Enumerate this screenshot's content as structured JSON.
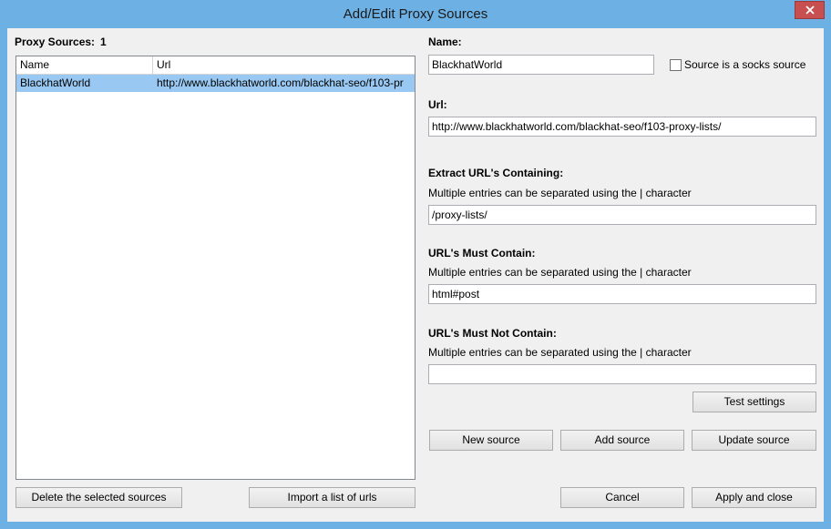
{
  "window": {
    "title": "Add/Edit Proxy Sources"
  },
  "sources": {
    "label": "Proxy Sources:",
    "count": "1",
    "columns": [
      "Name",
      "Url"
    ],
    "rows": [
      {
        "name": "BlackhatWorld",
        "url": "http://www.blackhatworld.com/blackhat-seo/f103-pr"
      }
    ],
    "delete_button": "Delete the selected sources",
    "import_button": "Import a list of urls"
  },
  "form": {
    "name_label": "Name:",
    "name_value": "BlackhatWorld",
    "socks_label": "Source is a socks source",
    "url_label": "Url:",
    "url_value": "http://www.blackhatworld.com/blackhat-seo/f103-proxy-lists/",
    "extract_label": "Extract URL's Containing:",
    "extract_hint": "Multiple entries can be separated using the | character",
    "extract_value": "/proxy-lists/",
    "must_contain_label": "URL's Must Contain:",
    "must_contain_hint": "Multiple entries can be separated using the | character",
    "must_contain_value": "html#post",
    "must_not_label": "URL's Must Not Contain:",
    "must_not_hint": "Multiple entries can be separated using the | character",
    "must_not_value": "",
    "test_button": "Test settings",
    "new_button": "New source",
    "add_button": "Add source",
    "update_button": "Update source",
    "cancel_button": "Cancel",
    "apply_button": "Apply and close"
  }
}
